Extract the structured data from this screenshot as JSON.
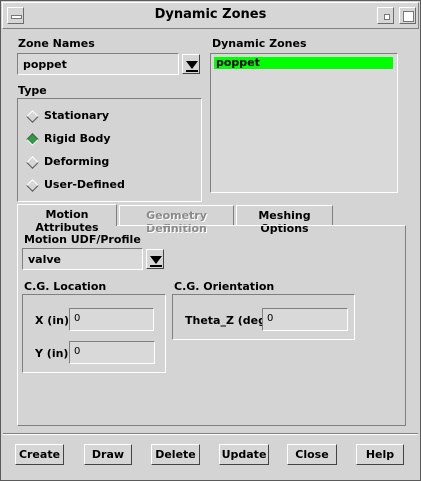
{
  "window": {
    "title": "Dynamic Zones"
  },
  "zone_names": {
    "label": "Zone Names",
    "selected": "poppet"
  },
  "dynamic_zones": {
    "label": "Dynamic Zones",
    "items": [
      "poppet"
    ],
    "selected_color": "#00ff00"
  },
  "type": {
    "label": "Type",
    "options": [
      {
        "label": "Stationary",
        "checked": false
      },
      {
        "label": "Rigid Body",
        "checked": true
      },
      {
        "label": "Deforming",
        "checked": false
      },
      {
        "label": "User-Defined",
        "checked": false
      }
    ]
  },
  "tabs": [
    {
      "label": "Motion Attributes",
      "active": true,
      "enabled": true
    },
    {
      "label": "Geometry Definition",
      "active": false,
      "enabled": false
    },
    {
      "label": "Meshing Options",
      "active": false,
      "enabled": true
    }
  ],
  "motion": {
    "udf_label": "Motion UDF/Profile",
    "udf_value": "valve",
    "cg_location_label": "C.G. Location",
    "x_label": "X (in)",
    "x_value": "0",
    "y_label": "Y (in)",
    "y_value": "0",
    "cg_orientation_label": "C.G. Orientation",
    "theta_label": "Theta_Z (deg)",
    "theta_value": "0"
  },
  "buttons": {
    "create": "Create",
    "draw": "Draw",
    "delete": "Delete",
    "update": "Update",
    "close": "Close",
    "help": "Help"
  }
}
